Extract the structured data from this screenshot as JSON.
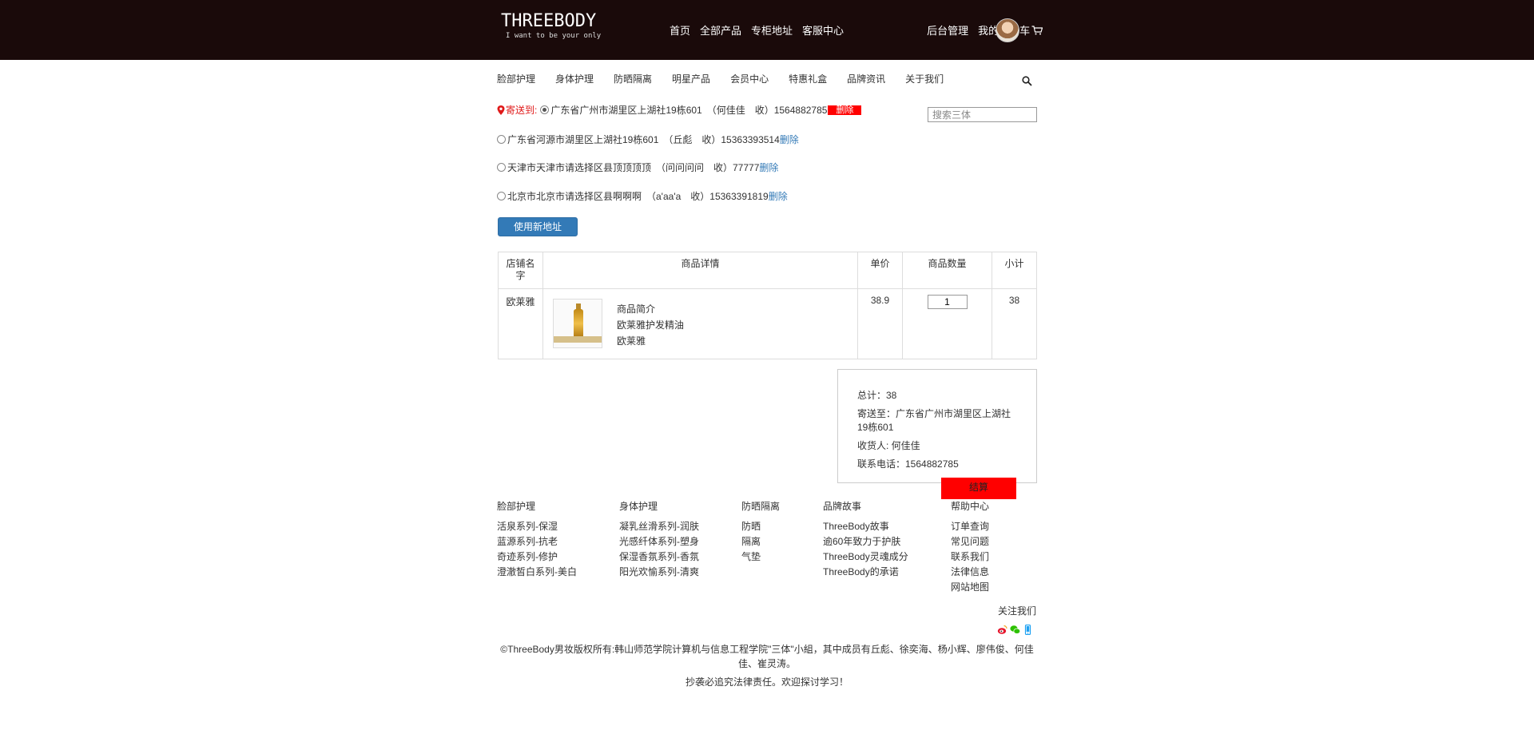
{
  "header": {
    "logo_main": "THREEBODY",
    "logo_sub": "I want to be your only",
    "nav": [
      "首页",
      "全部产品",
      "专柜地址",
      "客服中心"
    ],
    "admin": "后台管理",
    "cart": "我的购物车"
  },
  "category_nav": [
    "脸部护理",
    "身体护理",
    "防晒隔离",
    "明星产品",
    "会员中心",
    "特惠礼盒",
    "品牌资讯",
    "关于我们"
  ],
  "search": {
    "placeholder": "搜索三体"
  },
  "shipping": {
    "label": "寄送到:",
    "delete_badge": "删除",
    "addresses": [
      {
        "text": "广东省广州市湖里区上湖社19栋601　（何佳佳　收）1564882785",
        "selected": true
      },
      {
        "text": "广东省河源市湖里区上湖社19栋601　（丘彪　收）15363393514",
        "delete": "删除",
        "selected": false
      },
      {
        "text": "天津市天津市请选择区县顶顶顶顶　（问问问问　收）77777",
        "delete": "删除",
        "selected": false
      },
      {
        "text": "北京市北京市请选择区县啊啊啊　（a'aa'a　收）15363391819",
        "delete": "删除",
        "selected": false
      }
    ],
    "new_address_button": "使用新地址"
  },
  "cart_table": {
    "headers": [
      "店铺名字",
      "商品详情",
      "单价",
      "商品数量",
      "小计"
    ],
    "rows": [
      {
        "shop": "欧莱雅",
        "details": [
          "商品简介",
          "欧莱雅护发精油",
          "欧莱雅"
        ],
        "price": "38.9",
        "quantity": "1",
        "subtotal": "38"
      }
    ]
  },
  "summary": {
    "total": "总计：38",
    "ship_to": "寄送至：广东省广州市湖里区上湖社19栋601",
    "receiver": "收货人: 何佳佳",
    "phone": "联系电话：1564882785",
    "checkout": "结算"
  },
  "footer": {
    "columns": [
      {
        "title": "脸部护理",
        "links": [
          "活泉系列-保湿",
          "蓝源系列-抗老",
          "奇迹系列-修护",
          "澄澈皙白系列-美白"
        ]
      },
      {
        "title": "身体护理",
        "links": [
          "凝乳丝滑系列-润肤",
          "光感纤体系列-塑身",
          "保湿香氛系列-香氛",
          "阳光欢愉系列-清爽"
        ]
      },
      {
        "title": "防晒隔离",
        "links": [
          "防晒",
          "隔离",
          "气垫"
        ]
      },
      {
        "title": "品牌故事",
        "links": [
          "ThreeBody故事",
          "逾60年致力于护肤",
          "ThreeBody灵魂成分",
          "ThreeBody的承诺"
        ]
      },
      {
        "title": "帮助中心",
        "links": [
          "订单查询",
          "常见问题",
          "联系我们",
          "法律信息",
          "网站地图"
        ]
      }
    ],
    "follow": "关注我们",
    "social_icons": [
      "weibo-icon",
      "wechat-icon",
      "mobile-icon"
    ],
    "copyright": "©ThreeBody男妆版权所有:韩山师范学院计算机与信息工程学院\"三体\"小組，其中成员有丘彪、徐奕海、杨小辉、廖伟俊、何佳佳、崔灵涛。",
    "notice": "抄袭必追究法律责任。欢迎探讨学习！"
  },
  "colors": {
    "header_bg": "#1a0a0a",
    "accent_red": "#ff0000",
    "link_blue": "#337ab7"
  }
}
